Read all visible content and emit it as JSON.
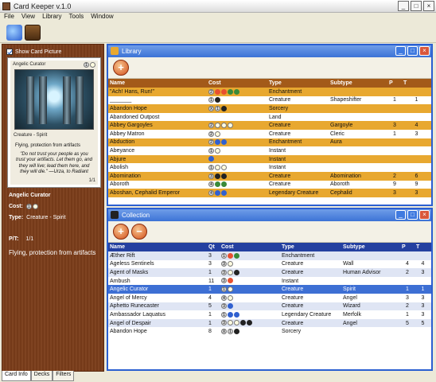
{
  "app": {
    "title": "Card Keeper v.1.0"
  },
  "menu": [
    "File",
    "View",
    "Library",
    "Tools",
    "Window"
  ],
  "left": {
    "show_card_label": "Show Card Picture",
    "card_flavor": "\"Do not trust your people as you trust your artifacts. Let them go, and they will live; lead them here, and they will die.\" —Urza, to Radiant",
    "card_text": "Flying, protection from artifacts",
    "card_name": "Angelic Curator",
    "cost_label": "Cost:",
    "type_label": "Type:",
    "type_value": "Creature - Spirit",
    "pt_label": "P/T:",
    "pt_value": "1/1",
    "rules_text": "Flying, protection from artifacts",
    "tabs": [
      "Card Info",
      "Decks",
      "Filters"
    ]
  },
  "library": {
    "title": "Library",
    "headers": [
      "Name",
      "Cost",
      "Type",
      "Subtype",
      "P",
      "T"
    ],
    "rows": [
      {
        "name": "\"Ach! Hans, Run!\"",
        "cost": [
          "2",
          "R",
          "R",
          "G",
          "G"
        ],
        "type": "Enchantment",
        "subtype": "",
        "p": "",
        "t": ""
      },
      {
        "name": "_______",
        "cost": [
          "1",
          "B"
        ],
        "type": "Creature",
        "subtype": "Shapeshifter",
        "p": "1",
        "t": "1"
      },
      {
        "name": "Abandon Hope",
        "cost": [
          "X",
          "1",
          "B"
        ],
        "type": "Sorcery",
        "subtype": "",
        "p": "",
        "t": ""
      },
      {
        "name": "Abandoned Outpost",
        "cost": [],
        "type": "Land",
        "subtype": "",
        "p": "",
        "t": ""
      },
      {
        "name": "Abbey Gargoyles",
        "cost": [
          "2",
          "W",
          "W",
          "W"
        ],
        "type": "Creature",
        "subtype": "Gargoyle",
        "p": "3",
        "t": "4"
      },
      {
        "name": "Abbey Matron",
        "cost": [
          "2",
          "W"
        ],
        "type": "Creature",
        "subtype": "Cleric",
        "p": "1",
        "t": "3"
      },
      {
        "name": "Abduction",
        "cost": [
          "2",
          "U",
          "U"
        ],
        "type": "Enchantment",
        "subtype": "Aura",
        "p": "",
        "t": ""
      },
      {
        "name": "Abeyance",
        "cost": [
          "1",
          "W"
        ],
        "type": "Instant",
        "subtype": "",
        "p": "",
        "t": ""
      },
      {
        "name": "Abjure",
        "cost": [
          "U"
        ],
        "type": "Instant",
        "subtype": "",
        "p": "",
        "t": ""
      },
      {
        "name": "Abolish",
        "cost": [
          "1",
          "W",
          "W"
        ],
        "type": "Instant",
        "subtype": "",
        "p": "",
        "t": ""
      },
      {
        "name": "Abomination",
        "cost": [
          "3",
          "B",
          "B"
        ],
        "type": "Creature",
        "subtype": "Abomination",
        "p": "2",
        "t": "6"
      },
      {
        "name": "Aboroth",
        "cost": [
          "4",
          "G",
          "G"
        ],
        "type": "Creature",
        "subtype": "Aboroth",
        "p": "9",
        "t": "9"
      },
      {
        "name": "Aboshan, Cephalid Emperor",
        "cost": [
          "4",
          "U",
          "U"
        ],
        "type": "Legendary Creature",
        "subtype": "Cephalid",
        "p": "3",
        "t": "3"
      }
    ]
  },
  "collection": {
    "title": "Collection",
    "headers": [
      "Name",
      "Qt",
      "Cost",
      "Type",
      "Subtype",
      "P",
      "T"
    ],
    "rows": [
      {
        "name": "Æther Rift",
        "qt": "3",
        "cost": [
          "1",
          "R",
          "G"
        ],
        "type": "Enchantment",
        "subtype": "",
        "p": "",
        "t": ""
      },
      {
        "name": "Ageless Sentinels",
        "qt": "3",
        "cost": [
          "3",
          "W"
        ],
        "type": "Creature",
        "subtype": "Wall",
        "p": "4",
        "t": "4"
      },
      {
        "name": "Agent of Masks",
        "qt": "1",
        "cost": [
          "3",
          "W",
          "B"
        ],
        "type": "Creature",
        "subtype": "Human Advisor",
        "p": "2",
        "t": "3"
      },
      {
        "name": "Ambush",
        "qt": "11",
        "cost": [
          "3",
          "R"
        ],
        "type": "Instant",
        "subtype": "",
        "p": "",
        "t": ""
      },
      {
        "name": "Angelic Curator",
        "qt": "1",
        "cost": [
          "1",
          "W"
        ],
        "type": "Creature",
        "subtype": "Spirit",
        "p": "1",
        "t": "1"
      },
      {
        "name": "Angel of Mercy",
        "qt": "4",
        "cost": [
          "4",
          "W"
        ],
        "type": "Creature",
        "subtype": "Angel",
        "p": "3",
        "t": "3"
      },
      {
        "name": "Aphetto Runecaster",
        "qt": "5",
        "cost": [
          "3",
          "U"
        ],
        "type": "Creature",
        "subtype": "Wizard",
        "p": "2",
        "t": "3"
      },
      {
        "name": "Ambassador Laquatus",
        "qt": "1",
        "cost": [
          "1",
          "U",
          "U"
        ],
        "type": "Legendary Creature",
        "subtype": "Merfolk",
        "p": "1",
        "t": "3"
      },
      {
        "name": "Angel of Despair",
        "qt": "1",
        "cost": [
          "3",
          "W",
          "W",
          "B",
          "B"
        ],
        "type": "Creature",
        "subtype": "Angel",
        "p": "5",
        "t": "5"
      },
      {
        "name": "Abandon Hope",
        "qt": "8",
        "cost": [
          "X",
          "1",
          "B"
        ],
        "type": "Sorcery",
        "subtype": "",
        "p": "",
        "t": ""
      }
    ],
    "selected_index": 4
  }
}
